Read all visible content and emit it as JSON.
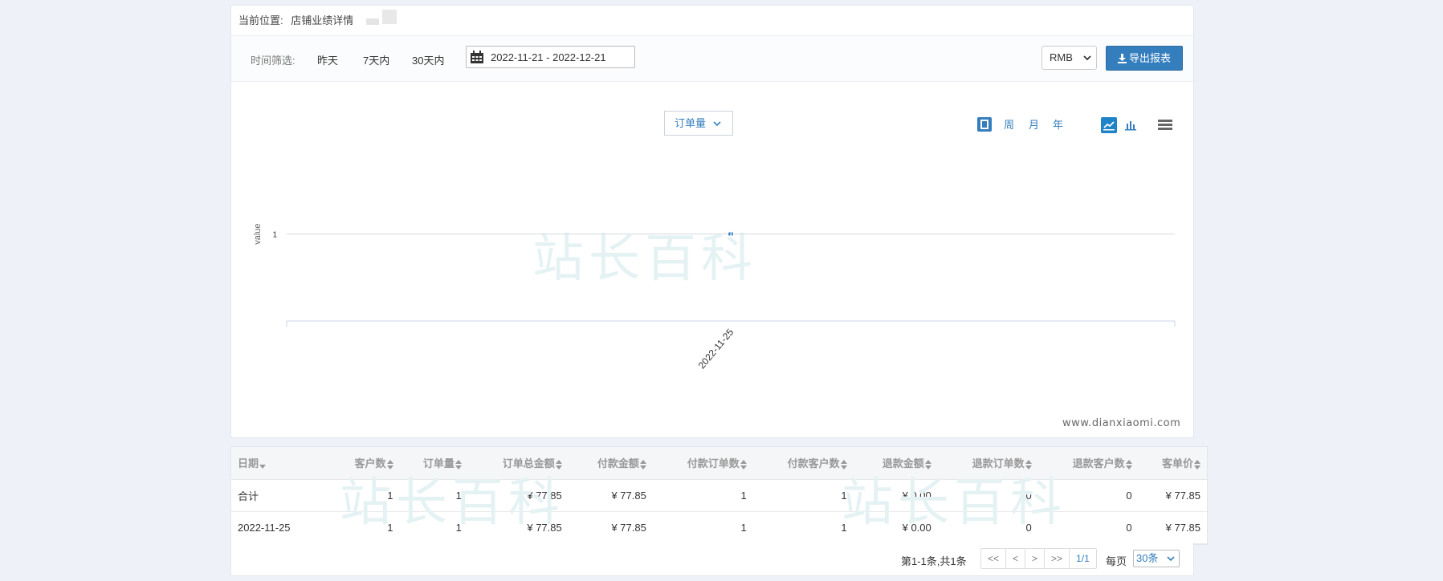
{
  "breadcrumb": {
    "label": "当前位置:",
    "current": "店铺业绩详情"
  },
  "filter": {
    "label": "时间筛选:",
    "options": [
      "昨天",
      "7天内",
      "30天内"
    ],
    "date_range": "2022-11-21 - 2022-12-21",
    "currency": "RMB",
    "export_label": "导出报表"
  },
  "chart_controls": {
    "metric": "订单量",
    "periods": [
      "周",
      "月",
      "年"
    ],
    "credit": "www.dianxiaomi.com"
  },
  "chart_data": {
    "type": "line",
    "x": [
      "2022-11-25"
    ],
    "series": [
      {
        "values": [
          1
        ]
      }
    ],
    "ylabel": "value",
    "y_ticks": [
      "1"
    ],
    "data_labels": [
      "1"
    ],
    "grid": true
  },
  "table": {
    "headers": [
      "日期",
      "客户数",
      "订单量",
      "订单总金额",
      "付款金额",
      "付款订单数",
      "付款客户数",
      "退款金额",
      "退款订单数",
      "退款客户数",
      "客单价"
    ],
    "rows": [
      [
        "合计",
        "1",
        "1",
        "¥ 77.85",
        "¥ 77.85",
        "1",
        "1",
        "¥ 0.00",
        "0",
        "0",
        "¥ 77.85"
      ],
      [
        "2022-11-25",
        "1",
        "1",
        "¥ 77.85",
        "¥ 77.85",
        "1",
        "1",
        "¥ 0.00",
        "0",
        "0",
        "¥ 77.85"
      ]
    ]
  },
  "pager": {
    "summary": "第1-1条,共1条",
    "buttons": [
      "<<",
      "<",
      ">",
      ">>",
      "1/1"
    ],
    "per_page_label": "每页",
    "per_page_value": "30条"
  },
  "colors": {
    "accent": "#357ebd",
    "header_bg": "#f5f6f8",
    "background": "#eef1f8"
  }
}
